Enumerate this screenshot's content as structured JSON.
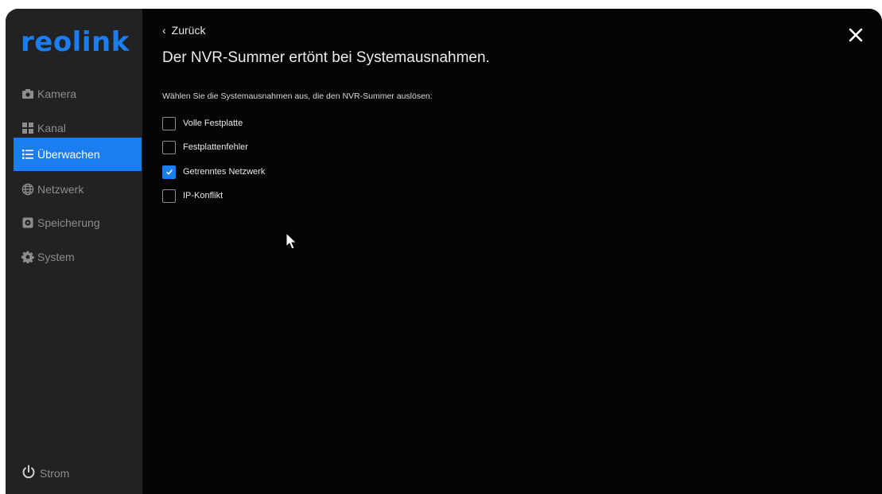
{
  "app": {
    "brand": "reolink"
  },
  "sidebar": {
    "items": [
      {
        "label": "Kamera",
        "icon": "camera-icon",
        "active": false
      },
      {
        "label": "Kanal",
        "icon": "channel-grid-icon",
        "active": false
      },
      {
        "label": "Überwachen",
        "icon": "list-icon",
        "active": true
      },
      {
        "label": "Netzwerk",
        "icon": "globe-icon",
        "active": false
      },
      {
        "label": "Speicherung",
        "icon": "storage-icon",
        "active": false
      },
      {
        "label": "System",
        "icon": "gear-icon",
        "active": false
      }
    ],
    "power_label": "Strom"
  },
  "main": {
    "back_label": "Zurück",
    "title": "Der NVR-Summer ertönt bei Systemausnahmen.",
    "instruction": "Wählen Sie die Systemausnahmen aus, die den NVR-Summer auslösen:",
    "options": [
      {
        "label": "Volle Festplatte",
        "checked": false
      },
      {
        "label": "Festplattenfehler",
        "checked": false
      },
      {
        "label": "Getrenntes Netzwerk",
        "checked": true
      },
      {
        "label": "IP-Konflikt",
        "checked": false
      }
    ]
  },
  "colors": {
    "accent": "#1b7ef0",
    "sidebar_bg": "#222224",
    "main_bg": "#050505"
  }
}
